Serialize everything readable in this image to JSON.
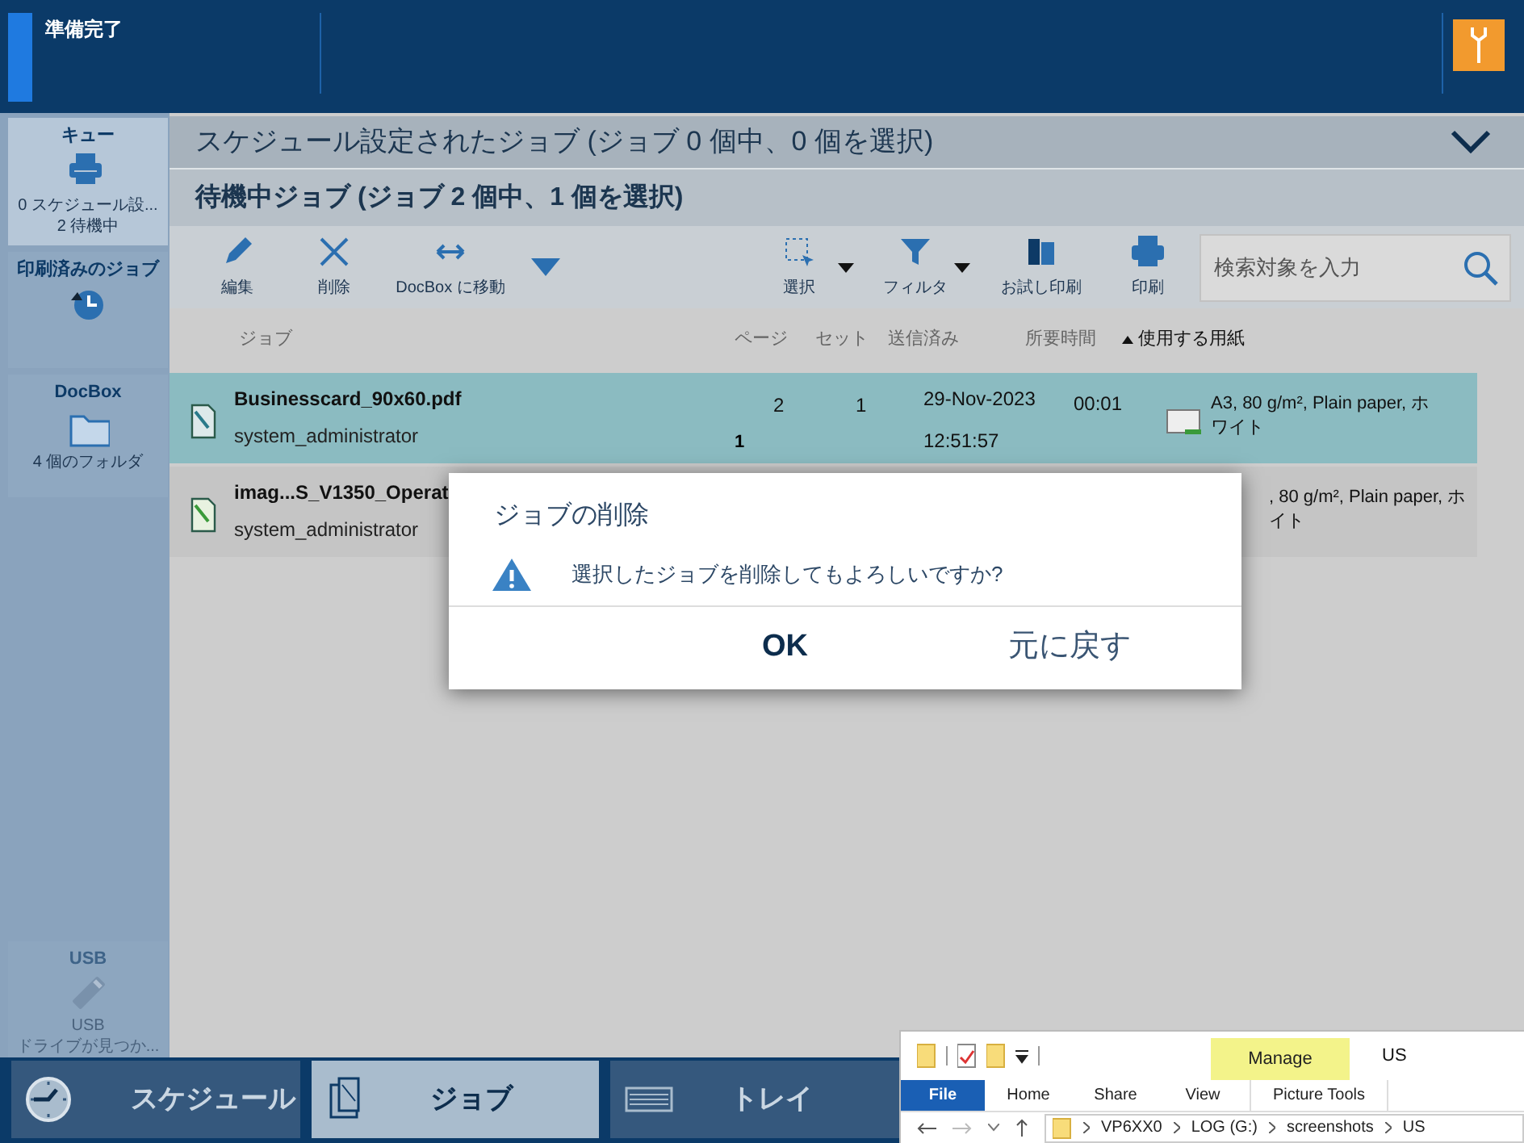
{
  "status": {
    "text": "準備完了"
  },
  "sidebar": {
    "items": [
      {
        "kind": "queue",
        "title": "キュー",
        "lines": [
          "0 スケジュール設...",
          "2 待機中"
        ],
        "selected": true,
        "disabled": false
      },
      {
        "kind": "printed",
        "title": "印刷済みのジョブ",
        "selected": false,
        "disabled": false
      },
      {
        "kind": "docbox",
        "title": "DocBox",
        "lines": [
          "4 個のフォルダ"
        ],
        "selected": false,
        "disabled": false
      },
      {
        "kind": "usb",
        "title": "USB",
        "lines": [
          "USB",
          "ドライブが見つか..."
        ],
        "selected": false,
        "disabled": true
      }
    ]
  },
  "scheduled": {
    "title": "スケジュール設定されたジョブ (ジョブ 0 個中、0 個を選択)",
    "expanded": false
  },
  "waiting": {
    "title": "待機中ジョブ (ジョブ 2 個中、1 個を選択)"
  },
  "toolbar": {
    "left": [
      {
        "kind": "edit",
        "label": "編集"
      },
      {
        "kind": "delete",
        "label": "削除"
      },
      {
        "kind": "move",
        "label": "DocBox に移動"
      }
    ],
    "right": [
      {
        "kind": "select",
        "label": "選択"
      },
      {
        "kind": "filter",
        "label": "フィルタ"
      },
      {
        "kind": "proof",
        "label": "お試し印刷"
      },
      {
        "kind": "print",
        "label": "印刷"
      }
    ]
  },
  "search": {
    "placeholder": "検索対象を入力"
  },
  "table": {
    "columns": [
      {
        "label": "ジョブ",
        "sorted": false
      },
      {
        "label": "ページ",
        "sorted": false
      },
      {
        "label": "セット",
        "sorted": false
      },
      {
        "label": "送信済み",
        "sorted": false
      },
      {
        "label": "所要時間",
        "sorted": false
      },
      {
        "label": "使用する用紙",
        "sorted": true
      }
    ],
    "rows": [
      {
        "kind": "document",
        "name": "Businesscard_90x60.pdf",
        "user": "system_administrator",
        "column_3": "1",
        "pages": "2",
        "sets": "1",
        "sent_date": "29-Nov-2023",
        "sent_time": "12:51:57",
        "duration": "00:01",
        "paper": [
          "A3, 80 g/m², Plain paper, ホ",
          "ワイト"
        ],
        "selected": true
      },
      {
        "kind": "image",
        "name": "imag...S_V1350_Operat",
        "user": "system_administrator",
        "paper": [
          ", 80 g/m², Plain paper, ホ",
          "イト"
        ],
        "selected": false
      }
    ]
  },
  "dialog": {
    "title": "ジョブの削除",
    "message": "選択したジョブを削除してもよろしいですか?",
    "buttons": [
      "OK",
      "元に戻す"
    ]
  },
  "bottom_nav": [
    {
      "kind": "clock",
      "label": "スケジュール",
      "selected": false
    },
    {
      "kind": "jobs",
      "label": "ジョブ",
      "selected": true
    },
    {
      "kind": "tray",
      "label": "トレイ",
      "selected": false
    }
  ],
  "explorer": {
    "title": "US",
    "context_tab": "Manage",
    "tabs": [
      {
        "kind": "file",
        "label": "File"
      },
      {
        "kind": "tab",
        "label": "Home"
      },
      {
        "kind": "tab",
        "label": "Share"
      },
      {
        "kind": "tab",
        "label": "View"
      },
      {
        "kind": "context",
        "label": "Picture Tools"
      }
    ],
    "path": [
      "VP6XX0",
      "LOG (G:)",
      "screenshots",
      "US"
    ]
  }
}
